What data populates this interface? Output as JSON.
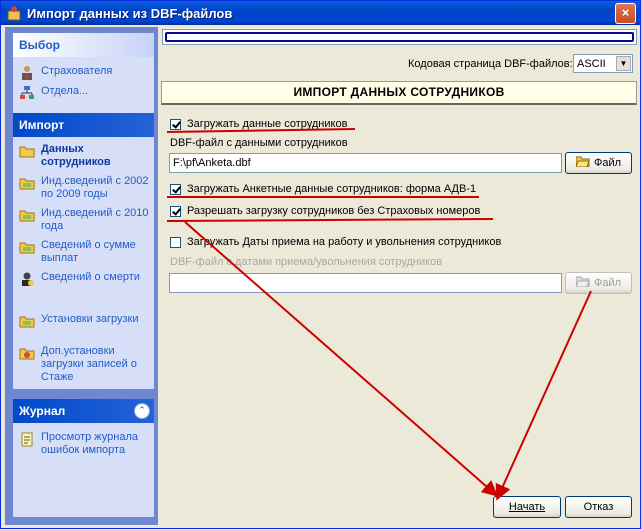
{
  "window": {
    "title": "Импорт данных из DBF-файлов",
    "close": "×"
  },
  "sidebar": {
    "select_group": {
      "title": "Выбор",
      "items": [
        {
          "label": "Страхователя"
        },
        {
          "label": "Отдела..."
        }
      ]
    },
    "import_group": {
      "title": "Импорт",
      "items": [
        {
          "label": "Данных сотрудников"
        },
        {
          "label": "Инд.сведений с 2002 по 2009 годы"
        },
        {
          "label": "Инд.сведений с 2010 года"
        },
        {
          "label": "Сведений о сумме выплат"
        },
        {
          "label": "Сведений о смерти"
        },
        {
          "label": "Установки загрузки"
        },
        {
          "label": "Доп.установки загрузки записей о Стаже"
        }
      ]
    },
    "journal_group": {
      "title": "Журнал",
      "collapse": "⌃",
      "items": [
        {
          "label": "Просмотр журнала ошибок импорта"
        }
      ]
    }
  },
  "codepage": {
    "label": "Кодовая страница DBF-файлов:",
    "value": "ASCII",
    "arrow": "▼"
  },
  "section": {
    "title": "ИМПОРТ ДАННЫХ СОТРУДНИКОВ"
  },
  "options": {
    "load_employees": {
      "label": "Загружать данные сотрудников",
      "checked": true
    },
    "dbf_label": "DBF-файл с данными сотрудников",
    "dbf_path": "F:\\pf\\Anketa.dbf",
    "file_button": "Файл",
    "load_adv1": {
      "label": "Загружать Анкетные данные сотрудников: форма АДВ-1",
      "checked": true
    },
    "allow_no_insurance": {
      "label": "Разрешать загрузку сотрудников без Страховых номеров",
      "checked": true
    },
    "load_dates": {
      "label": "Загружать Даты приема на работу и увольнения сотрудников",
      "checked": false
    },
    "dates_dbf_label": "DBF-файл с датами приема/увольнения сотрудников",
    "dates_dbf_path": "",
    "dates_file_button": "Файл"
  },
  "footer": {
    "start": "Начать",
    "cancel": "Отказ"
  },
  "colors": {
    "annotation": "#cc0000",
    "accent": "#215dc6"
  }
}
